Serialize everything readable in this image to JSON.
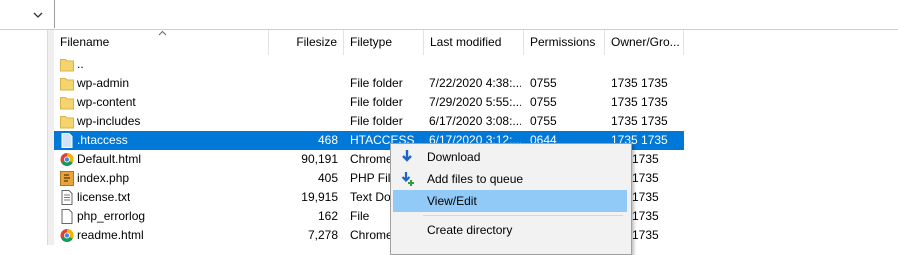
{
  "columns": {
    "filename": "Filename",
    "filesize": "Filesize",
    "filetype": "Filetype",
    "last_modified": "Last modified",
    "permissions": "Permissions",
    "owner_group": "Owner/Gro..."
  },
  "rows": [
    {
      "name": "..",
      "size": "",
      "type": "",
      "modified": "",
      "perm": "",
      "owner": "",
      "icon": "folder-icon"
    },
    {
      "name": "wp-admin",
      "size": "",
      "type": "File folder",
      "modified": "7/22/2020 4:38:...",
      "perm": "0755",
      "owner": "1735 1735",
      "icon": "folder-icon"
    },
    {
      "name": "wp-content",
      "size": "",
      "type": "File folder",
      "modified": "7/29/2020 5:55:...",
      "perm": "0755",
      "owner": "1735 1735",
      "icon": "folder-icon"
    },
    {
      "name": "wp-includes",
      "size": "",
      "type": "File folder",
      "modified": "6/17/2020 3:08:...",
      "perm": "0755",
      "owner": "1735 1735",
      "icon": "folder-icon"
    },
    {
      "name": ".htaccess",
      "size": "468",
      "type": "HTACCESS",
      "modified": "6/17/2020 3:12:...",
      "perm": "0644",
      "owner": "1735 1735",
      "icon": "file-icon",
      "selected": true
    },
    {
      "name": "Default.html",
      "size": "90,191",
      "type": "Chrome",
      "modified": "",
      "perm": "",
      "owner": "1735",
      "icon": "chrome-icon"
    },
    {
      "name": "index.php",
      "size": "405",
      "type": "PHP File",
      "modified": "",
      "perm": "",
      "owner": "1735",
      "icon": "php-icon"
    },
    {
      "name": "license.txt",
      "size": "19,915",
      "type": "Text Do",
      "modified": "",
      "perm": "",
      "owner": "1735",
      "icon": "text-icon"
    },
    {
      "name": "php_errorlog",
      "size": "162",
      "type": "File",
      "modified": "",
      "perm": "",
      "owner": "1735",
      "icon": "file-icon"
    },
    {
      "name": "readme.html",
      "size": "7,278",
      "type": "Chrome",
      "modified": "",
      "perm": "",
      "owner": "1735",
      "icon": "chrome-icon"
    }
  ],
  "context_menu": {
    "download": "Download",
    "add_to_queue": "Add files to queue",
    "view_edit": "View/Edit",
    "create_directory": "Create directory"
  },
  "colors": {
    "selection": "#0078d7",
    "menu_hover": "#91c9f7",
    "folder": "#f5d470"
  }
}
